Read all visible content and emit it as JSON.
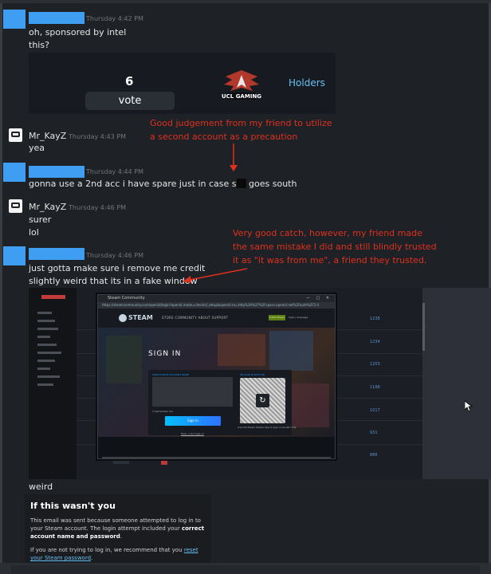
{
  "messages": [
    {
      "timestamp": "Thursday 4:42 PM",
      "lines": [
        "oh, sponsored by intel",
        "this?"
      ]
    },
    {
      "author": "Mr_KayZ",
      "timestamp": "Thursday 4:43 PM",
      "lines": [
        "yea"
      ]
    },
    {
      "timestamp": "Thursday 4:44 PM",
      "line_pre": "gonna use a 2nd acc i have spare just in case s",
      "line_post": "goes south"
    },
    {
      "author": "Mr_KayZ",
      "timestamp": "Thursday 4:46 PM",
      "lines": [
        "surer",
        "lol"
      ]
    },
    {
      "timestamp": "Thursday 4:46 PM",
      "lines": [
        "just gotta make sure i remove me credit",
        "slightly weird that its in a fake window"
      ]
    }
  ],
  "embed_card": {
    "count": "6",
    "vote_label": "vote",
    "brand_text": "UCL GAMING",
    "holders_label": "Holders"
  },
  "annotations": {
    "first": [
      "Good judgement from my friend to utilize",
      "a second account as a precaution"
    ],
    "second": [
      "Very good catch, however, my friend made",
      "the same mistake I did and still blindly trusted",
      "it as \"it was from me\", a friend they trusted."
    ],
    "color": "#e0301e"
  },
  "screenshot_embed": {
    "numbers": [
      "1238",
      "1234",
      "1203",
      "1188",
      "1017",
      "931",
      "886"
    ],
    "popup": {
      "title": "Steam Community",
      "address": "https://steamcommunity.com/openid/login?openid.mode=checkid_setup&openid.ns=http%3A%2F%2Fspecs.openid.net%2Fauth%2F2.0",
      "steam_word": "STEAM",
      "nav": "STORE   COMMUNITY   ABOUT   SUPPORT",
      "install_label": "Install Steam",
      "login_label": "login  |  language",
      "signin_title": "SIGN IN",
      "account_label": "SIGN IN WITH ACCOUNT NAME",
      "qr_label": "OR SIGN IN WITH QR",
      "remember_label": "Remember me",
      "signin_button": "Sign in",
      "help_label": "Help, I can't sign in",
      "qr_caption": "Use the Steam Mobile App to sign in via QR code"
    }
  },
  "after_embed_message": "weird",
  "email": {
    "title": "If this wasn't you",
    "p1_pre": "This email was sent because someone attempted to log in to your Steam account. The login attempt included your ",
    "p1_bold": "correct account name and password",
    "p1_post": ".",
    "p2_pre": "If you are not trying to log in, we recommend that you ",
    "p2_link": "reset your Steam password",
    "p2_post": "."
  },
  "colors": {
    "redact_blue": "#3f9ef1",
    "background": "#1e2126",
    "link": "#66c0f4"
  }
}
